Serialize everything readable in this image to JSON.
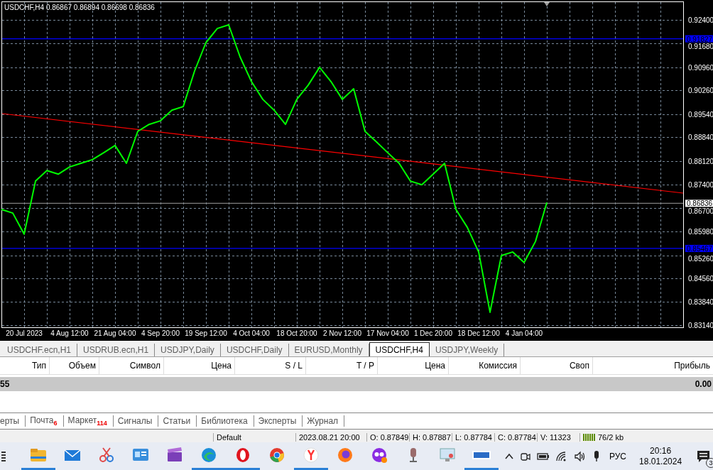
{
  "chart": {
    "title": "USDCHF,H4  0.86867 0.86894 0.86698 0.86836",
    "chart_data": {
      "type": "line",
      "ylim": [
        0.8314,
        0.924
      ],
      "yticks": [
        {
          "value": 0.924,
          "label": "0.92400"
        },
        {
          "value": 0.9168,
          "label": "0.91680"
        },
        {
          "value": 0.9096,
          "label": "0.90960"
        },
        {
          "value": 0.9026,
          "label": "0.90260"
        },
        {
          "value": 0.8954,
          "label": "0.89540"
        },
        {
          "value": 0.8884,
          "label": "0.88840"
        },
        {
          "value": 0.8812,
          "label": "0.88120"
        },
        {
          "value": 0.874,
          "label": "0.87400"
        },
        {
          "value": 0.867,
          "label": "0.86700"
        },
        {
          "value": 0.8598,
          "label": "0.85980"
        },
        {
          "value": 0.8526,
          "label": "0.85260"
        },
        {
          "value": 0.8456,
          "label": "0.84560"
        },
        {
          "value": 0.8384,
          "label": "0.83840"
        },
        {
          "value": 0.8314,
          "label": "0.83140"
        }
      ],
      "grid": true,
      "categories": [
        null,
        null,
        "20 Jul 2023",
        null,
        null,
        null,
        "4 Aug 12:00",
        null,
        null,
        null,
        "21 Aug 04:00",
        null,
        null,
        null,
        "4 Sep 20:00",
        null,
        null,
        null,
        "19 Sep 12:00",
        null,
        null,
        null,
        "4 Oct 04:00",
        null,
        null,
        null,
        "18 Oct 20:00",
        null,
        null,
        null,
        "2 Nov 12:00",
        null,
        null,
        null,
        "17 Nov 04:00",
        null,
        null,
        null,
        "1 Dec 20:00",
        null,
        null,
        null,
        "18 Dec 12:00",
        null,
        null,
        null,
        "4 Jan 04:00",
        null,
        null
      ],
      "ref_lines": [
        {
          "axis": "y",
          "value": 0.91827,
          "label": "0.91827",
          "color": "#0000ff"
        },
        {
          "axis": "y",
          "value": 0.86836,
          "label": "0.86836",
          "color": "#808080"
        },
        {
          "axis": "y",
          "value": 0.85467,
          "label": "0.85467",
          "color": "#0000ff"
        }
      ],
      "series": [
        {
          "color": "#00ff00",
          "values": [
            0.8665,
            0.8654,
            0.859,
            0.8751,
            0.8783,
            0.8772,
            0.8794,
            0.8805,
            0.8816,
            0.8837,
            0.8859,
            0.8805,
            0.8902,
            0.8923,
            0.8934,
            0.8966,
            0.8977,
            0.9085,
            0.9171,
            0.9214,
            0.9225,
            0.9128,
            0.9053,
            0.8999,
            0.8966,
            0.8923,
            0.8999,
            0.9042,
            0.9096,
            0.9053,
            0.8999,
            0.9031,
            0.8902,
            0.887,
            0.8837,
            0.8805,
            0.8751,
            0.874,
            0.8772,
            0.8805,
            0.8665,
            0.8611,
            0.8536,
            0.8353,
            0.8525,
            0.8536,
            0.8504,
            0.8568,
            0.8686
          ]
        }
      ]
    }
  },
  "chart_tabs": [
    {
      "label": "USDCHF.ecn,H1",
      "selected": false
    },
    {
      "label": "USDRUB.ecn,H1",
      "selected": false
    },
    {
      "label": "USDJPY,Daily",
      "selected": false
    },
    {
      "label": "USDCHF,Daily",
      "selected": false
    },
    {
      "label": "EURUSD,Monthly",
      "selected": false
    },
    {
      "label": "USDCHF,H4",
      "selected": true
    },
    {
      "label": "USDJPY,Weekly",
      "selected": false
    }
  ],
  "table": {
    "columns": [
      "Тип",
      "Объем",
      "Символ",
      "Цена",
      "S / L",
      "T / P",
      "Цена",
      "Комиссия",
      "Своп",
      "Прибыль"
    ],
    "balance_row": {
      "first": "55",
      "last": "0.00"
    }
  },
  "terminal_tabs": [
    {
      "label": "ерты"
    },
    {
      "label": "Почта",
      "badge": "6"
    },
    {
      "label": "Маркет",
      "badge": "114"
    },
    {
      "label": "Сигналы"
    },
    {
      "label": "Статьи"
    },
    {
      "label": "Библиотека"
    },
    {
      "label": "Эксперты"
    },
    {
      "label": "Журнал"
    }
  ],
  "status_bar": [
    "Default",
    "2023.08.21 20:00",
    "O: 0.87849",
    "H: 0.87887",
    "L: 0.87784",
    "C: 0.87784",
    "V: 11323",
    "76/2 kb"
  ],
  "taskbar": {
    "apps": [
      {
        "kind": "folder",
        "running": true
      },
      {
        "kind": "mail",
        "running": false
      },
      {
        "kind": "scissors",
        "running": false
      },
      {
        "kind": "card",
        "running": false
      },
      {
        "kind": "clapper",
        "running": false
      },
      {
        "kind": "edge",
        "running": true
      },
      {
        "kind": "opera",
        "running": true
      },
      {
        "kind": "chrome",
        "running": false
      },
      {
        "kind": "yandex",
        "running": true
      },
      {
        "kind": "firefox",
        "running": false
      },
      {
        "kind": "mask",
        "running": false
      },
      {
        "kind": "mic",
        "running": false
      },
      {
        "kind": "screen",
        "running": false
      },
      {
        "kind": "ecn",
        "running": true
      }
    ],
    "language": "РУС",
    "time": "20:16",
    "date": "18.01.2024",
    "notifications": "3"
  }
}
